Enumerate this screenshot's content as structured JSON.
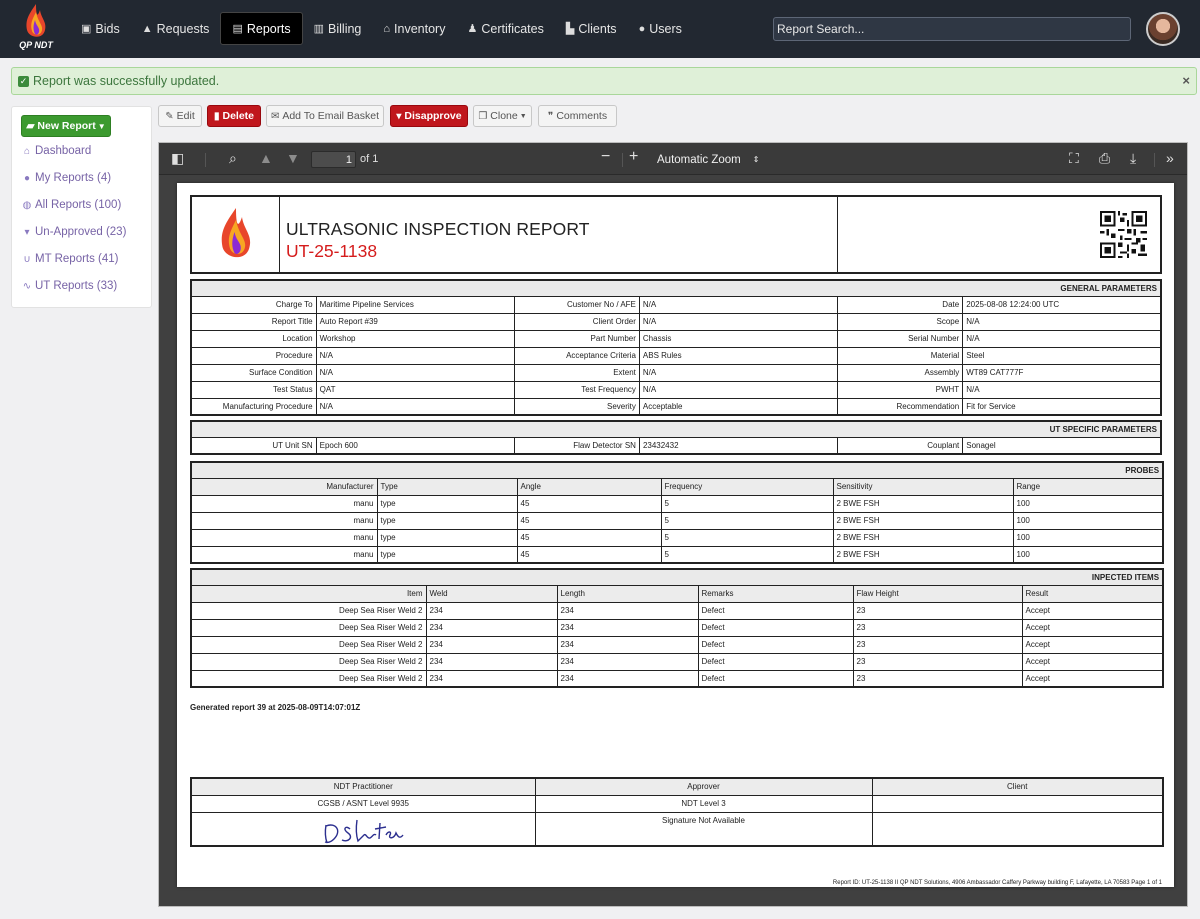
{
  "app": {
    "logo_text": "QP NDT",
    "search_placeholder": "Report Search..."
  },
  "nav": [
    {
      "label": "Bids",
      "icon": "inbox-icon",
      "active": false
    },
    {
      "label": "Requests",
      "icon": "bell-icon",
      "active": false
    },
    {
      "label": "Reports",
      "icon": "file-icon",
      "active": true
    },
    {
      "label": "Billing",
      "icon": "receipt-icon",
      "active": false
    },
    {
      "label": "Inventory",
      "icon": "warehouse-icon",
      "active": false
    },
    {
      "label": "Certificates",
      "icon": "stamp-icon",
      "active": false
    },
    {
      "label": "Clients",
      "icon": "industry-icon",
      "active": false
    },
    {
      "label": "Users",
      "icon": "users-icon",
      "active": false
    }
  ],
  "alert": {
    "message": "Report was successfully updated.",
    "close": "×"
  },
  "sidebar": {
    "new_report": "New Report",
    "items": [
      {
        "label": "Dashboard",
        "icon": "home-icon"
      },
      {
        "label": "My Reports (4)",
        "icon": "user-icon"
      },
      {
        "label": "All Reports (100)",
        "icon": "globe-icon"
      },
      {
        "label": "Un-Approved (23)",
        "icon": "thumbs-down-icon"
      },
      {
        "label": "MT Reports (41)",
        "icon": "magnet-icon"
      },
      {
        "label": "UT Reports (33)",
        "icon": "wave-icon"
      }
    ]
  },
  "toolbar": {
    "edit": "Edit",
    "delete": "Delete",
    "email": "Add To Email Basket",
    "disapprove": "Disapprove",
    "clone": "Clone",
    "comments": "Comments"
  },
  "viewer": {
    "page_value": "1",
    "page_count": "of 1",
    "zoom": "Automatic Zoom"
  },
  "report": {
    "title": "ULTRASONIC INSPECTION REPORT",
    "number": "UT-25-1138",
    "general_title": "GENERAL PARAMETERS",
    "general_rows": [
      [
        "Charge To",
        "Maritime Pipeline Services",
        "Customer No / AFE",
        "N/A",
        "Date",
        "2025-08-08 12:24:00 UTC"
      ],
      [
        "Report Title",
        "Auto Report #39",
        "Client Order",
        "N/A",
        "Scope",
        "N/A"
      ],
      [
        "Location",
        "Workshop",
        "Part Number",
        "Chassis",
        "Serial Number",
        "N/A"
      ],
      [
        "Procedure",
        "N/A",
        "Acceptance Criteria",
        "ABS Rules",
        "Material",
        "Steel"
      ],
      [
        "Surface Condition",
        "N/A",
        "Extent",
        "N/A",
        "Assembly",
        "WT89 CAT777F"
      ],
      [
        "Test Status",
        "QAT",
        "Test Frequency",
        "N/A",
        "PWHT",
        "N/A"
      ],
      [
        "Manufacturing Procedure",
        "N/A",
        "Severity",
        "Acceptable",
        "Recommendation",
        "Fit for Service"
      ]
    ],
    "ut_title": "UT SPECIFIC PARAMETERS",
    "ut_row": [
      "UT Unit SN",
      "Epoch 600",
      "Flaw Detector SN",
      "23432432",
      "Couplant",
      "Sonagel"
    ],
    "probes_title": "PROBES",
    "probes_headers": [
      "Manufacturer",
      "Type",
      "Angle",
      "Frequency",
      "Sensitivity",
      "Range"
    ],
    "probes_rows": [
      [
        "manu",
        "type",
        "45",
        "5",
        "2 BWE FSH",
        "100"
      ],
      [
        "manu",
        "type",
        "45",
        "5",
        "2 BWE FSH",
        "100"
      ],
      [
        "manu",
        "type",
        "45",
        "5",
        "2 BWE FSH",
        "100"
      ],
      [
        "manu",
        "type",
        "45",
        "5",
        "2 BWE FSH",
        "100"
      ]
    ],
    "items_title": "INPECTED ITEMS",
    "items_headers": [
      "Item",
      "Weld",
      "Length",
      "Remarks",
      "Flaw Height",
      "Result"
    ],
    "items_rows": [
      [
        "Deep Sea Riser Weld 2",
        "234",
        "234",
        "Defect",
        "23",
        "Accept"
      ],
      [
        "Deep Sea Riser Weld 2",
        "234",
        "234",
        "Defect",
        "23",
        "Accept"
      ],
      [
        "Deep Sea Riser Weld 2",
        "234",
        "234",
        "Defect",
        "23",
        "Accept"
      ],
      [
        "Deep Sea Riser Weld 2",
        "234",
        "234",
        "Defect",
        "23",
        "Accept"
      ],
      [
        "Deep Sea Riser Weld 2",
        "234",
        "234",
        "Defect",
        "23",
        "Accept"
      ]
    ],
    "generated": "Generated report 39 at 2025-08-09T14:07:01Z",
    "sig_headers": [
      "NDT Practitioner",
      "Approver",
      "Client"
    ],
    "sig_levels": [
      "CGSB / ASNT Level 9935",
      "NDT Level 3",
      ""
    ],
    "sig_approver_note": "Signature Not Available",
    "signature": "D Slater",
    "footer": "Report ID: UT-25-1138 II QP NDT Solutions, 4906 Ambassador Caffery Parkway building F, Lafayette, LA 70583 Page 1 of 1"
  },
  "colors": {
    "navbar": "#222831",
    "accent_red": "#c0171d",
    "green": "#3c9a2f",
    "report_number": "#d51c1c"
  }
}
